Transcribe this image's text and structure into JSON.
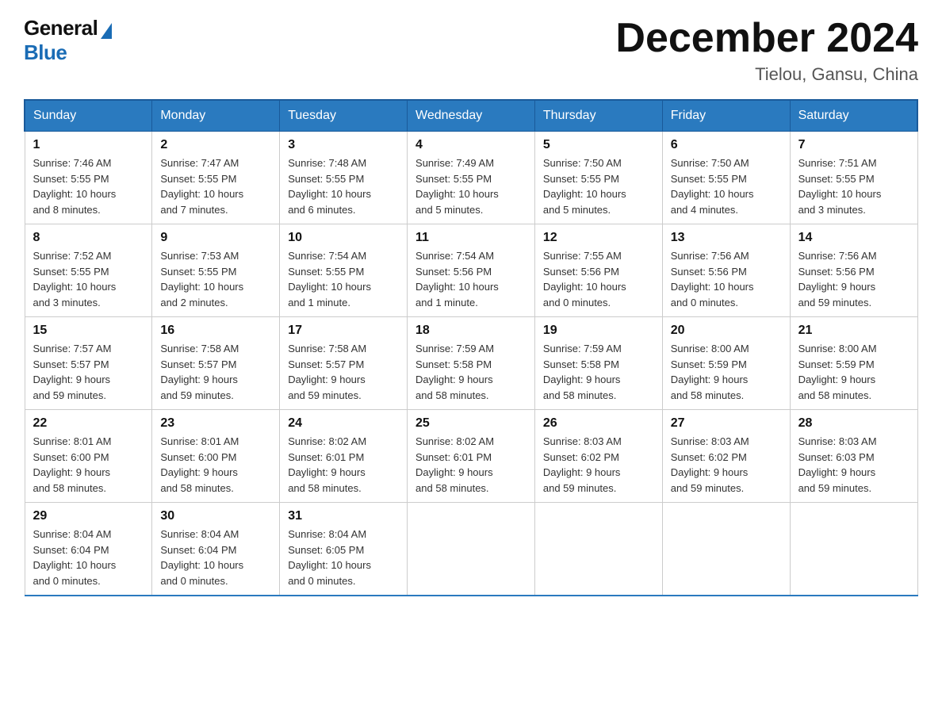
{
  "header": {
    "logo_general": "General",
    "logo_blue": "Blue",
    "title": "December 2024",
    "location": "Tielou, Gansu, China"
  },
  "weekdays": [
    "Sunday",
    "Monday",
    "Tuesday",
    "Wednesday",
    "Thursday",
    "Friday",
    "Saturday"
  ],
  "weeks": [
    [
      {
        "day": "1",
        "info": "Sunrise: 7:46 AM\nSunset: 5:55 PM\nDaylight: 10 hours\nand 8 minutes."
      },
      {
        "day": "2",
        "info": "Sunrise: 7:47 AM\nSunset: 5:55 PM\nDaylight: 10 hours\nand 7 minutes."
      },
      {
        "day": "3",
        "info": "Sunrise: 7:48 AM\nSunset: 5:55 PM\nDaylight: 10 hours\nand 6 minutes."
      },
      {
        "day": "4",
        "info": "Sunrise: 7:49 AM\nSunset: 5:55 PM\nDaylight: 10 hours\nand 5 minutes."
      },
      {
        "day": "5",
        "info": "Sunrise: 7:50 AM\nSunset: 5:55 PM\nDaylight: 10 hours\nand 5 minutes."
      },
      {
        "day": "6",
        "info": "Sunrise: 7:50 AM\nSunset: 5:55 PM\nDaylight: 10 hours\nand 4 minutes."
      },
      {
        "day": "7",
        "info": "Sunrise: 7:51 AM\nSunset: 5:55 PM\nDaylight: 10 hours\nand 3 minutes."
      }
    ],
    [
      {
        "day": "8",
        "info": "Sunrise: 7:52 AM\nSunset: 5:55 PM\nDaylight: 10 hours\nand 3 minutes."
      },
      {
        "day": "9",
        "info": "Sunrise: 7:53 AM\nSunset: 5:55 PM\nDaylight: 10 hours\nand 2 minutes."
      },
      {
        "day": "10",
        "info": "Sunrise: 7:54 AM\nSunset: 5:55 PM\nDaylight: 10 hours\nand 1 minute."
      },
      {
        "day": "11",
        "info": "Sunrise: 7:54 AM\nSunset: 5:56 PM\nDaylight: 10 hours\nand 1 minute."
      },
      {
        "day": "12",
        "info": "Sunrise: 7:55 AM\nSunset: 5:56 PM\nDaylight: 10 hours\nand 0 minutes."
      },
      {
        "day": "13",
        "info": "Sunrise: 7:56 AM\nSunset: 5:56 PM\nDaylight: 10 hours\nand 0 minutes."
      },
      {
        "day": "14",
        "info": "Sunrise: 7:56 AM\nSunset: 5:56 PM\nDaylight: 9 hours\nand 59 minutes."
      }
    ],
    [
      {
        "day": "15",
        "info": "Sunrise: 7:57 AM\nSunset: 5:57 PM\nDaylight: 9 hours\nand 59 minutes."
      },
      {
        "day": "16",
        "info": "Sunrise: 7:58 AM\nSunset: 5:57 PM\nDaylight: 9 hours\nand 59 minutes."
      },
      {
        "day": "17",
        "info": "Sunrise: 7:58 AM\nSunset: 5:57 PM\nDaylight: 9 hours\nand 59 minutes."
      },
      {
        "day": "18",
        "info": "Sunrise: 7:59 AM\nSunset: 5:58 PM\nDaylight: 9 hours\nand 58 minutes."
      },
      {
        "day": "19",
        "info": "Sunrise: 7:59 AM\nSunset: 5:58 PM\nDaylight: 9 hours\nand 58 minutes."
      },
      {
        "day": "20",
        "info": "Sunrise: 8:00 AM\nSunset: 5:59 PM\nDaylight: 9 hours\nand 58 minutes."
      },
      {
        "day": "21",
        "info": "Sunrise: 8:00 AM\nSunset: 5:59 PM\nDaylight: 9 hours\nand 58 minutes."
      }
    ],
    [
      {
        "day": "22",
        "info": "Sunrise: 8:01 AM\nSunset: 6:00 PM\nDaylight: 9 hours\nand 58 minutes."
      },
      {
        "day": "23",
        "info": "Sunrise: 8:01 AM\nSunset: 6:00 PM\nDaylight: 9 hours\nand 58 minutes."
      },
      {
        "day": "24",
        "info": "Sunrise: 8:02 AM\nSunset: 6:01 PM\nDaylight: 9 hours\nand 58 minutes."
      },
      {
        "day": "25",
        "info": "Sunrise: 8:02 AM\nSunset: 6:01 PM\nDaylight: 9 hours\nand 58 minutes."
      },
      {
        "day": "26",
        "info": "Sunrise: 8:03 AM\nSunset: 6:02 PM\nDaylight: 9 hours\nand 59 minutes."
      },
      {
        "day": "27",
        "info": "Sunrise: 8:03 AM\nSunset: 6:02 PM\nDaylight: 9 hours\nand 59 minutes."
      },
      {
        "day": "28",
        "info": "Sunrise: 8:03 AM\nSunset: 6:03 PM\nDaylight: 9 hours\nand 59 minutes."
      }
    ],
    [
      {
        "day": "29",
        "info": "Sunrise: 8:04 AM\nSunset: 6:04 PM\nDaylight: 10 hours\nand 0 minutes."
      },
      {
        "day": "30",
        "info": "Sunrise: 8:04 AM\nSunset: 6:04 PM\nDaylight: 10 hours\nand 0 minutes."
      },
      {
        "day": "31",
        "info": "Sunrise: 8:04 AM\nSunset: 6:05 PM\nDaylight: 10 hours\nand 0 minutes."
      },
      null,
      null,
      null,
      null
    ]
  ]
}
